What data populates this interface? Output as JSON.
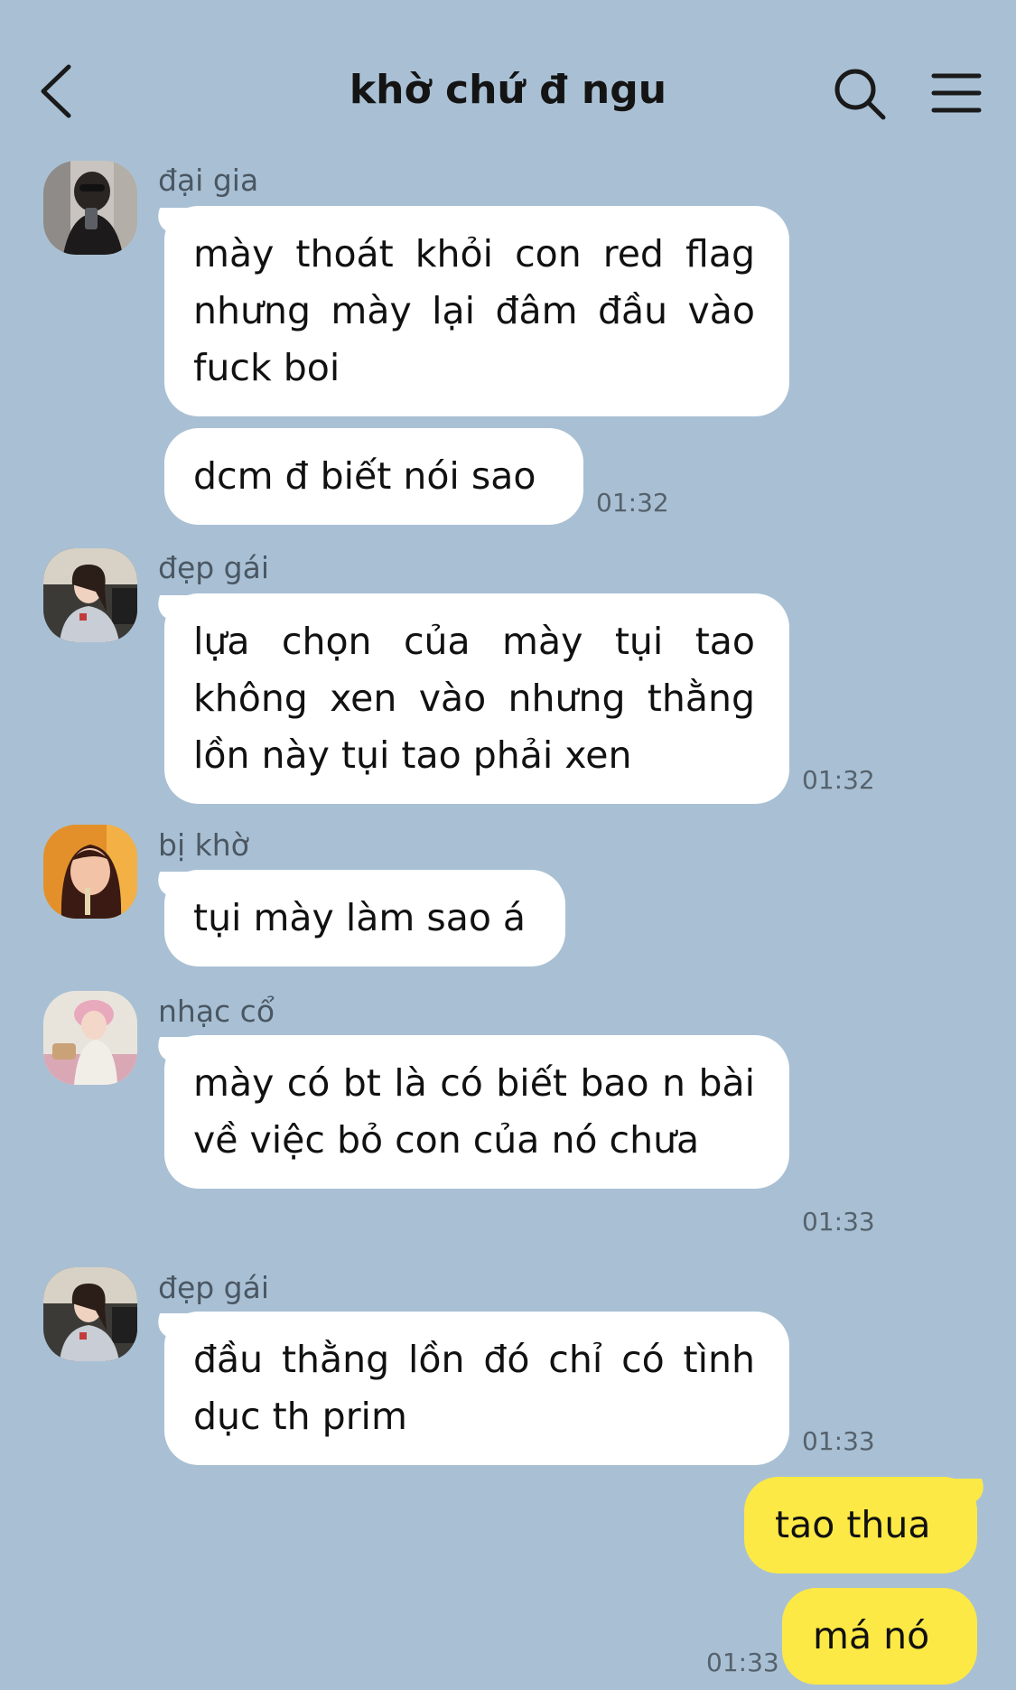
{
  "header": {
    "title": "khờ chứ đ ngu",
    "back_icon": "chevron-left-icon",
    "search_icon": "search-icon",
    "menu_icon": "hamburger-menu-icon"
  },
  "colors": {
    "background": "#a9c0d4",
    "incoming_bubble": "#ffffff",
    "outgoing_bubble": "#fde945"
  },
  "messages": [
    {
      "sender": "đại gia",
      "bubbles": [
        "mày thoát khỏi con red flag nhưng mày lại đâm đầu vào fuck boi",
        "dcm đ biết nói sao"
      ],
      "time": "01:32"
    },
    {
      "sender": "đẹp gái",
      "bubbles": [
        "lựa chọn của mày tụi tao không xen vào nhưng thằng lồn này tụi tao phải xen"
      ],
      "time": "01:32"
    },
    {
      "sender": "bị khờ",
      "bubbles": [
        "tụi mày làm sao á"
      ],
      "time": ""
    },
    {
      "sender": "nhạc cổ",
      "bubbles": [
        "mày có bt là có biết bao n bài về việc bỏ con của nó chưa"
      ],
      "time": "01:33"
    },
    {
      "sender": "đẹp gái",
      "bubbles": [
        "đầu thằng lồn đó chỉ có tình dục th prim"
      ],
      "time": "01:33"
    }
  ],
  "my_messages": {
    "bubbles": [
      "tao thua",
      "má nó"
    ],
    "time": "01:33"
  }
}
